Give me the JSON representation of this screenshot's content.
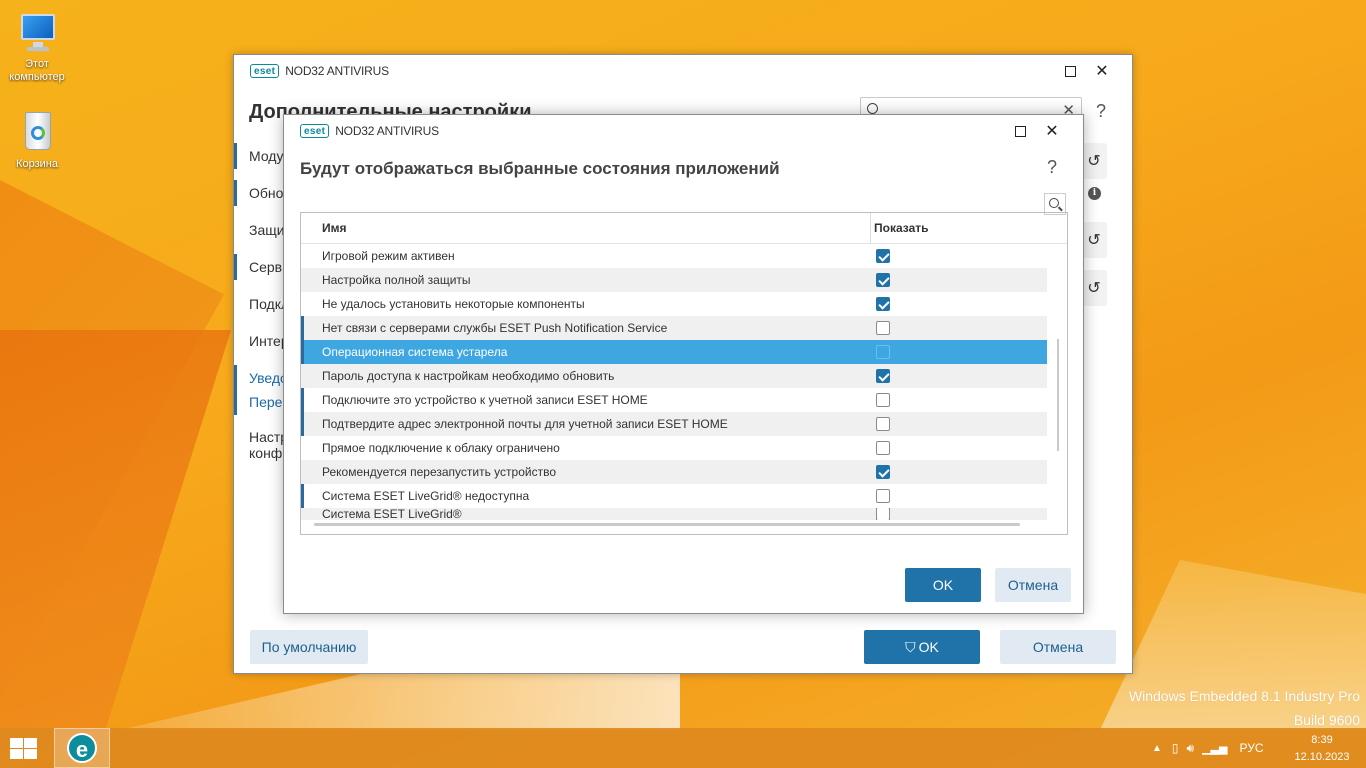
{
  "desktop": {
    "icons": [
      {
        "label": "Этот компьютер"
      },
      {
        "label": "Корзина"
      }
    ],
    "watermark": {
      "line1": "Windows Embedded 8.1 Industry Pro",
      "line2": "Build 9600"
    }
  },
  "main_window": {
    "brand": "eset",
    "product": "NOD32 ANTIVIRUS",
    "heading": "Дополнительные настройки",
    "search_value": "",
    "help": "?",
    "sidebar": [
      {
        "label": "Модули"
      },
      {
        "label": "Обновление"
      },
      {
        "label": "Защита"
      },
      {
        "label": "Сервис"
      },
      {
        "label": "Подключения"
      },
      {
        "label": "Интерфейс"
      },
      {
        "label": "Уведомления"
      },
      {
        "label": "Переадресация"
      },
      {
        "label": "Настройки конфиденциальности"
      }
    ],
    "default_button": "По умолчанию",
    "ok_button": "OK",
    "cancel_button": "Отмена"
  },
  "dialog": {
    "brand": "eset",
    "product": "NOD32 ANTIVIRUS",
    "heading": "Будут отображаться выбранные состояния приложений",
    "help": "?",
    "columns": {
      "name": "Имя",
      "show": "Показать"
    },
    "rows": [
      {
        "name": "Игровой режим активен",
        "checked": true
      },
      {
        "name": "Настройка полной защиты",
        "checked": true
      },
      {
        "name": "Не удалось установить некоторые компоненты",
        "checked": true
      },
      {
        "name": "Нет связи с серверами службы ESET Push Notification Service",
        "checked": false
      },
      {
        "name": "Операционная система устарела",
        "checked": false
      },
      {
        "name": "Пароль доступа к настройкам необходимо обновить",
        "checked": true
      },
      {
        "name": "Подключите это устройство к учетной записи ESET HOME",
        "checked": false
      },
      {
        "name": "Подтвердите адрес электронной почты для учетной записи ESET HOME",
        "checked": false
      },
      {
        "name": "Прямое подключение к облаку ограничено",
        "checked": false
      },
      {
        "name": "Рекомендуется перезапустить устройство",
        "checked": true
      },
      {
        "name": "Система ESET LiveGrid® недоступна",
        "checked": false
      },
      {
        "name": "Система ESET LiveGrid®",
        "checked": false
      }
    ],
    "ok_button": "OK",
    "cancel_button": "Отмена"
  },
  "taskbar": {
    "language": "РУС",
    "time": "8:39",
    "date": "12.10.2023"
  },
  "colors": {
    "accent": "#1f73a8",
    "selection": "#3ea6e1",
    "eset_teal": "#0a8a9a"
  }
}
